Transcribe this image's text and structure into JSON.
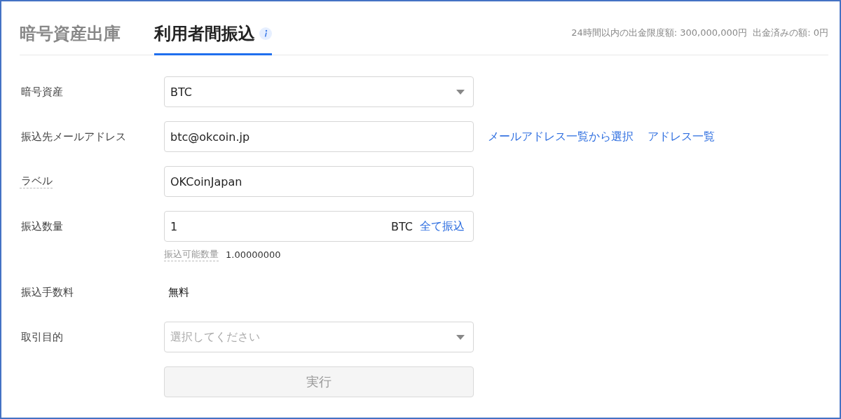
{
  "tabs": [
    {
      "label": "暗号資産出庫",
      "selected": false,
      "info": false
    },
    {
      "label": "利用者間振込",
      "selected": true,
      "info": true
    }
  ],
  "limit_info": "24時間以内の出金限度額: 300,000,000円  出金済みの額: 0円",
  "rows": [
    {
      "kind": "select",
      "label": "暗号資産",
      "dotted": false,
      "value": "BTC"
    },
    {
      "kind": "input",
      "label": "振込先メールアドレス",
      "dotted": false,
      "value": "btc@okcoin.jp",
      "links": [
        "メールアドレス一覧から選択",
        "アドレス一覧"
      ]
    },
    {
      "kind": "input",
      "label": "ラベル",
      "dotted": true,
      "value": "OKCoinJapan"
    },
    {
      "kind": "amount",
      "label": "振込数量",
      "dotted": false,
      "value": "1",
      "unit": "BTC",
      "action": "全て振込",
      "hint_label": "振込可能数量",
      "hint_value": "1.00000000"
    },
    {
      "kind": "static",
      "label": "振込手数料",
      "dotted": false,
      "value": "無料"
    },
    {
      "kind": "select",
      "label": "取引目的",
      "dotted": false,
      "placeholder": "選択してください"
    }
  ],
  "submit": {
    "label": "実行",
    "disabled": true
  }
}
